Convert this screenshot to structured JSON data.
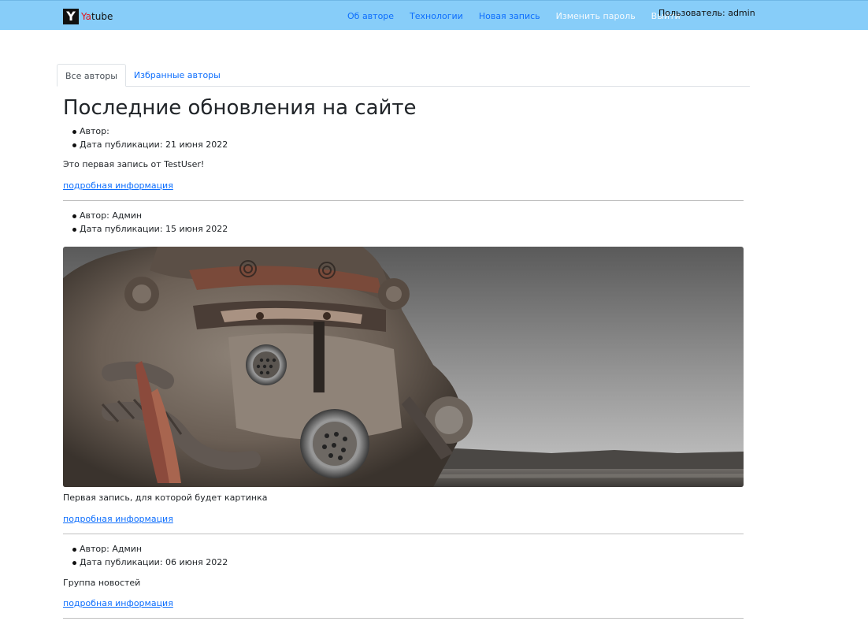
{
  "navbar": {
    "brand_logo": "Y",
    "brand_ya": "Ya",
    "brand_tube": "tube",
    "links": [
      {
        "label": "Об авторе"
      },
      {
        "label": "Технологии"
      },
      {
        "label": "Новая запись"
      },
      {
        "label": "Изменить пароль"
      },
      {
        "label": "Выйти"
      }
    ],
    "user_label": "Пользователь: admin",
    "background_color": "#87cdf9"
  },
  "tabs": [
    {
      "label": "Все авторы",
      "active": true
    },
    {
      "label": "Избранные авторы",
      "active": false
    }
  ],
  "page_title": "Последние обновления на сайте",
  "posts": [
    {
      "author": "Автор: ",
      "date": "Дата публикации: 21 июня 2022",
      "text": "Это первая запись от TestUser!",
      "more": "подробная информация"
    },
    {
      "author": "Автор: Админ",
      "date": "Дата публикации: 15 июня 2022",
      "image": "power-armor-helmet-image",
      "text": "Первая запись, для которой будет картинка",
      "more": "подробная информация"
    },
    {
      "author": "Автор: Админ",
      "date": "Дата публикации: 06 июня 2022",
      "text": "Группа новостей",
      "more": "подробная информация"
    }
  ]
}
